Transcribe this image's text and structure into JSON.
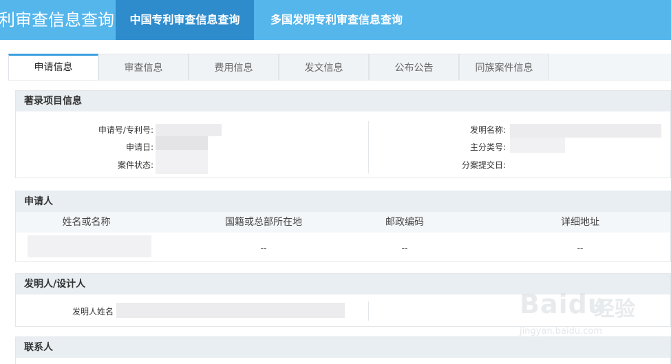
{
  "header": {
    "brand": "利审查信息查询",
    "nav": [
      {
        "label": "中国专利审查信息查询",
        "active": true
      },
      {
        "label": "多国发明专利审查信息查询",
        "active": false
      }
    ]
  },
  "tabs": [
    {
      "label": "申请信息",
      "active": true
    },
    {
      "label": "审查信息",
      "active": false
    },
    {
      "label": "费用信息",
      "active": false
    },
    {
      "label": "发文信息",
      "active": false
    },
    {
      "label": "公布公告",
      "active": false
    },
    {
      "label": "同族案件信息",
      "active": false
    }
  ],
  "biblio": {
    "title": "著录项目信息",
    "left": [
      {
        "label": "申请号/专利号:"
      },
      {
        "label": "申请日:"
      },
      {
        "label": "案件状态:"
      }
    ],
    "right": [
      {
        "label": "发明名称:"
      },
      {
        "label": "主分类号:"
      },
      {
        "label": "分案提交日:"
      }
    ]
  },
  "applicant": {
    "title": "申请人",
    "columns": [
      "姓名或名称",
      "国籍或总部所在地",
      "邮政编码",
      "详细地址"
    ],
    "row": {
      "nationality": "--",
      "postal": "--",
      "address": "--"
    }
  },
  "inventor": {
    "title": "发明人/设计人",
    "label": "发明人姓名"
  },
  "contact": {
    "title": "联系人"
  },
  "watermark": {
    "logo": "Bai",
    "logo2": "du",
    "cn": "经验",
    "url": "jingyan.baidu.com"
  },
  "colors": {
    "header_bg": "#55b6ec",
    "nav_active_bg": "#2e8ccd",
    "tab_active_border": "#3aa0e0",
    "section_title_bg": "#e9eef2"
  }
}
